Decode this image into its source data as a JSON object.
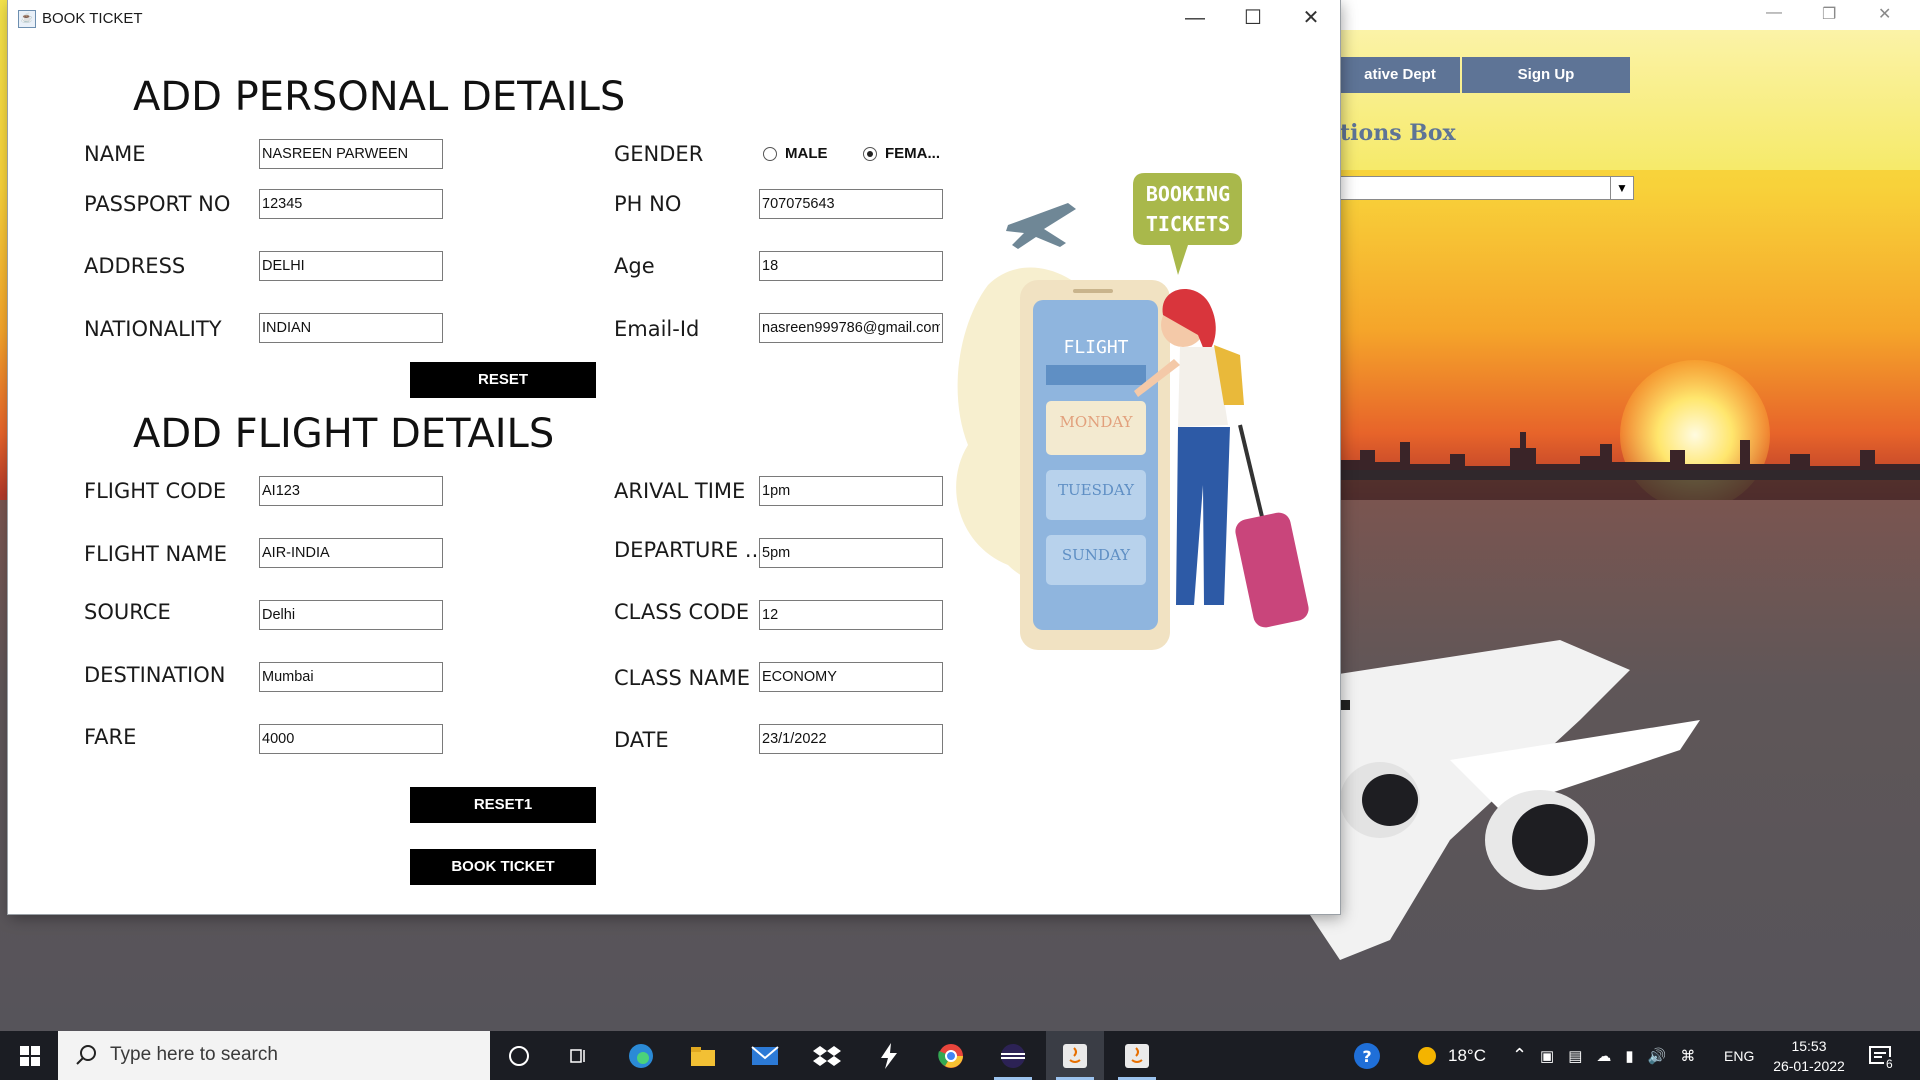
{
  "window": {
    "title": "BOOK TICKET"
  },
  "personal": {
    "heading": "ADD PERSONAL DETAILS",
    "name_label": "NAME",
    "name_value": "NASREEN PARWEEN",
    "passport_label": "PASSPORT NO",
    "passport_value": "12345",
    "address_label": "ADDRESS",
    "address_value": "DELHI",
    "nationality_label": "NATIONALITY",
    "nationality_value": "INDIAN",
    "gender_label": "GENDER",
    "gender_options": [
      "MALE",
      "FEMA..."
    ],
    "gender_selected": "FEMA...",
    "phone_label": "PH NO",
    "phone_value": "707075643",
    "age_label": "Age",
    "age_value": "18",
    "email_label": "Email-Id",
    "email_value": "nasreen999786@gmail.com",
    "reset_label": "RESET"
  },
  "flight": {
    "heading": "ADD FLIGHT DETAILS",
    "code_label": "FLIGHT CODE",
    "code_value": "AI123",
    "name_label": "FLIGHT NAME",
    "name_value": "AIR-INDIA",
    "source_label": "SOURCE",
    "source_value": "Delhi",
    "destination_label": "DESTINATION",
    "destination_value": "Mumbai",
    "fare_label": "FARE",
    "fare_value": "4000",
    "arrival_label": "ARIVAL TIME",
    "arrival_value": "1pm",
    "departure_label": "DEPARTURE ...",
    "departure_value": "5pm",
    "class_code_label": "CLASS CODE",
    "class_code_value": "12",
    "class_name_label": "CLASS NAME",
    "class_name_value": "ECONOMY",
    "date_label": "DATE",
    "date_value": "23/1/2022",
    "reset_label": "RESET1",
    "book_label": "BOOK TICKET"
  },
  "illustration": {
    "bubble_line1": "BOOKING",
    "bubble_line2": "TICKETS",
    "phone_header": "FLIGHT",
    "day1": "MONDAY",
    "day2": "TUESDAY",
    "day3": "SUNDAY"
  },
  "background_app": {
    "nav_left": "ative Dept",
    "nav_right": "Sign Up",
    "options_heading": "tions Box"
  },
  "taskbar": {
    "search_placeholder": "Type here to search",
    "weather": "18°C",
    "language": "ENG",
    "time": "15:53",
    "date": "26-01-2022",
    "notification_count": "6"
  },
  "colors": {
    "window_bg": "#ffffff",
    "button_bg": "#000000",
    "nav_button": "#5e7496",
    "taskbar": "#1b1d23"
  }
}
